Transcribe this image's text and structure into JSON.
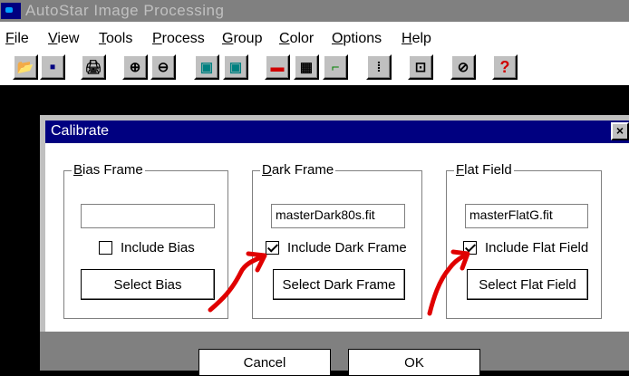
{
  "app": {
    "title": "AutoStar Image Processing"
  },
  "menu": [
    "File",
    "View",
    "Tools",
    "Process",
    "Group",
    "Color",
    "Options",
    "Help"
  ],
  "toolbar": [
    {
      "icon": "open-folder-icon",
      "glyph": "📂"
    },
    {
      "icon": "save-disk-icon",
      "glyph": "▪"
    },
    {
      "icon": "print-icon",
      "glyph": "🖨"
    },
    {
      "icon": "zoom-in-icon",
      "glyph": "⊕"
    },
    {
      "icon": "zoom-out-icon",
      "glyph": "⊖"
    },
    {
      "icon": "copy-image-icon",
      "glyph": "▣"
    },
    {
      "icon": "paste-image-icon",
      "glyph": "▣"
    },
    {
      "icon": "color-bar-icon",
      "glyph": "▬"
    },
    {
      "icon": "grid-icon",
      "glyph": "▦"
    },
    {
      "icon": "curve-icon",
      "glyph": "⌐"
    },
    {
      "icon": "dot-matrix-icon",
      "glyph": "⁞"
    },
    {
      "icon": "crop-icon",
      "glyph": "⊡"
    },
    {
      "icon": "telescope-icon",
      "glyph": "⊘"
    },
    {
      "icon": "help-icon",
      "glyph": "?"
    }
  ],
  "dialog": {
    "title": "Calibrate",
    "close": "×",
    "bias": {
      "legend": "Bias Frame",
      "file": "",
      "include_label": "Include Bias",
      "include_checked": false,
      "button": "Select Bias"
    },
    "dark": {
      "legend": "Dark Frame",
      "file": "masterDark80s.fit",
      "include_label": "Include Dark Frame",
      "include_checked": true,
      "button": "Select Dark Frame"
    },
    "flat": {
      "legend": "Flat Field",
      "file": "masterFlatG.fit",
      "include_label": "Include Flat Field",
      "include_checked": true,
      "button": "Select Flat Field"
    },
    "cancel": "Cancel",
    "ok": "OK"
  },
  "colors": {
    "title_bg": "#000080",
    "window_bg": "#c0c0c0",
    "annotation_arrow": "#e00000"
  }
}
